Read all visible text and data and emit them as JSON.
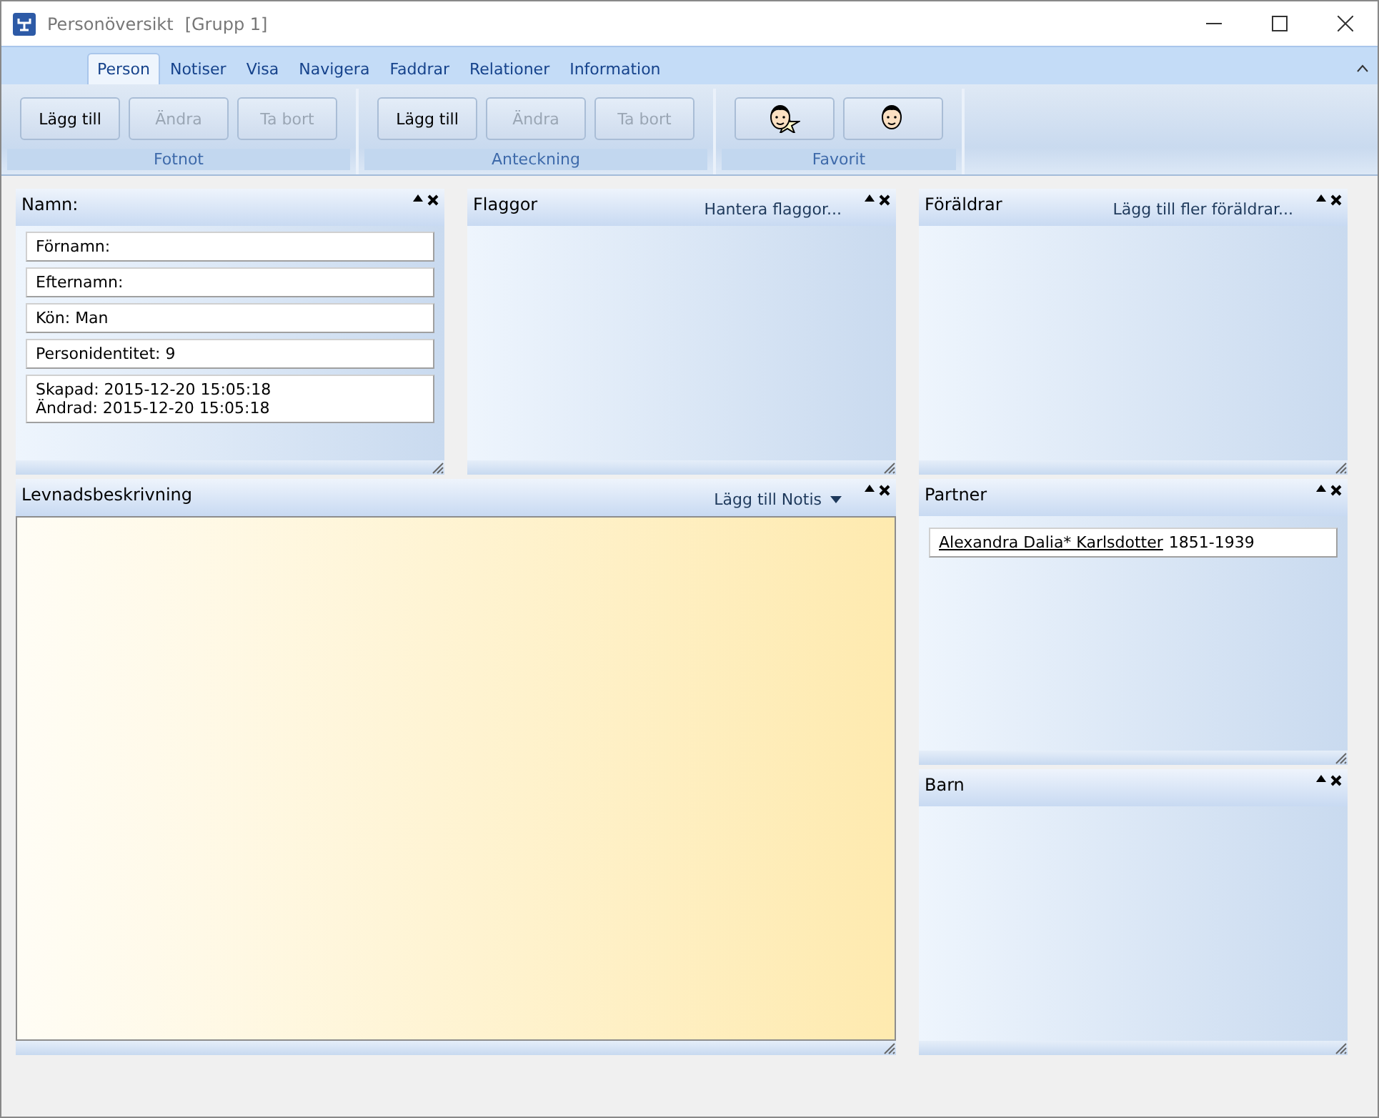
{
  "window": {
    "title": "Personöversikt",
    "subtitle": "[Grupp 1]"
  },
  "tabs": [
    {
      "label": "Person",
      "selected": true
    },
    {
      "label": "Notiser",
      "selected": false
    },
    {
      "label": "Visa",
      "selected": false
    },
    {
      "label": "Navigera",
      "selected": false
    },
    {
      "label": "Faddrar",
      "selected": false
    },
    {
      "label": "Relationer",
      "selected": false
    },
    {
      "label": "Information",
      "selected": false
    }
  ],
  "ribbon_groups": [
    {
      "label": "Fotnot",
      "buttons": [
        {
          "kind": "text",
          "label": "Lägg till",
          "disabled": false
        },
        {
          "kind": "text",
          "label": "Ändra",
          "disabled": true
        },
        {
          "kind": "text",
          "label": "Ta bort",
          "disabled": true
        }
      ]
    },
    {
      "label": "Anteckning",
      "buttons": [
        {
          "kind": "text",
          "label": "Lägg till",
          "disabled": false
        },
        {
          "kind": "text",
          "label": "Ändra",
          "disabled": true
        },
        {
          "kind": "text",
          "label": "Ta bort",
          "disabled": true
        }
      ]
    },
    {
      "label": "Favorit",
      "buttons": [
        {
          "kind": "face-star",
          "disabled": false
        },
        {
          "kind": "face",
          "disabled": false
        }
      ]
    }
  ],
  "panels": {
    "name": {
      "title": "Namn:",
      "fields": [
        "Förnamn:",
        "Efternamn:",
        "Kön: Man",
        "Personidentitet: 9"
      ],
      "dates": [
        "Skapad: 2015-12-20 15:05:18",
        "Ändrad: 2015-12-20 15:05:18"
      ]
    },
    "flags": {
      "title": "Flaggor",
      "action": "Hantera flaggor..."
    },
    "parents": {
      "title": "Föräldrar",
      "action": "Lägg till fler föräldrar..."
    },
    "biography": {
      "title": "Levnadsbeskrivning",
      "action": "Lägg till Notis"
    },
    "partner": {
      "title": "Partner",
      "people": [
        {
          "name": "Alexandra Dalia* Karlsdotter",
          "years": "1851-1939"
        }
      ]
    },
    "children": {
      "title": "Barn"
    }
  }
}
